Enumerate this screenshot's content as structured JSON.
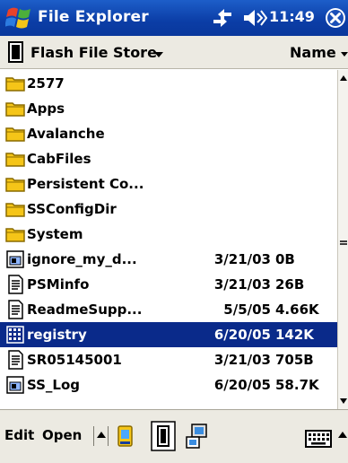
{
  "title_bar": {
    "app_title": "File Explorer",
    "clock": "11:49"
  },
  "location_bar": {
    "folder": "Flash File Store",
    "sort_by": "Name"
  },
  "files": [
    {
      "name": "2577",
      "date": "",
      "size": "",
      "type": "folder",
      "selected": false
    },
    {
      "name": "Apps",
      "date": "",
      "size": "",
      "type": "folder",
      "selected": false
    },
    {
      "name": "Avalanche",
      "date": "",
      "size": "",
      "type": "folder",
      "selected": false
    },
    {
      "name": "CabFiles",
      "date": "",
      "size": "",
      "type": "folder",
      "selected": false
    },
    {
      "name": "Persistent Co...",
      "date": "",
      "size": "",
      "type": "folder",
      "selected": false
    },
    {
      "name": "SSConfigDir",
      "date": "",
      "size": "",
      "type": "folder",
      "selected": false
    },
    {
      "name": "System",
      "date": "",
      "size": "",
      "type": "folder",
      "selected": false
    },
    {
      "name": "ignore_my_d...",
      "date": "3/21/03",
      "size": "0B",
      "type": "app",
      "selected": false
    },
    {
      "name": "PSMinfo",
      "date": "3/21/03",
      "size": "26B",
      "type": "doc",
      "selected": false
    },
    {
      "name": "ReadmeSupp...",
      "date": "5/5/05",
      "size": "4.66K",
      "type": "doc",
      "selected": false
    },
    {
      "name": "registry",
      "date": "6/20/05",
      "size": "142K",
      "type": "reg",
      "selected": true
    },
    {
      "name": "SR05145001",
      "date": "3/21/03",
      "size": "705B",
      "type": "doc",
      "selected": false
    },
    {
      "name": "SS_Log",
      "date": "6/20/05",
      "size": "58.7K",
      "type": "app",
      "selected": false
    }
  ],
  "command_bar": {
    "edit_label": "Edit",
    "open_label": "Open"
  }
}
